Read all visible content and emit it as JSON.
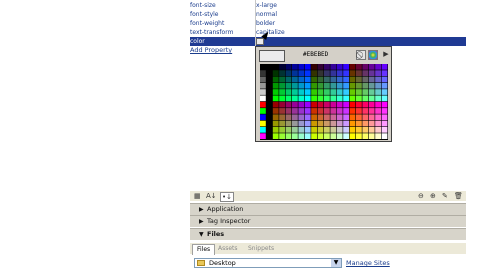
{
  "properties": [
    {
      "name": "font-size",
      "value": "x-large"
    },
    {
      "name": "font-style",
      "value": "normal"
    },
    {
      "name": "font-weight",
      "value": "bolder"
    },
    {
      "name": "text-transform",
      "value": "capitalize"
    },
    {
      "name": "color",
      "value": ""
    }
  ],
  "add_property_label": "Add Property",
  "picker": {
    "hex": "#EBEBED",
    "preview_color": "#EBEBED",
    "no_color_icon": "no-color-icon",
    "system_picker_icon": "color-wheel-icon",
    "menu_icon": "right-arrow-icon"
  },
  "toolbar": {
    "icons_left": [
      "show-category-view-icon",
      "sort-alpha-icon",
      "show-set-props-icon"
    ],
    "icons_right": [
      "attach-stylesheet-icon",
      "new-rule-icon",
      "edit-rule-icon",
      "delete-rule-icon"
    ]
  },
  "panels": [
    {
      "label": "Application",
      "expanded": false
    },
    {
      "label": "Tag Inspector",
      "expanded": false
    },
    {
      "label": "Files",
      "expanded": true
    }
  ],
  "tabs": [
    "Files",
    "Assets",
    "Snippets"
  ],
  "files": {
    "location": "Desktop",
    "manage_link": "Manage Sites"
  }
}
